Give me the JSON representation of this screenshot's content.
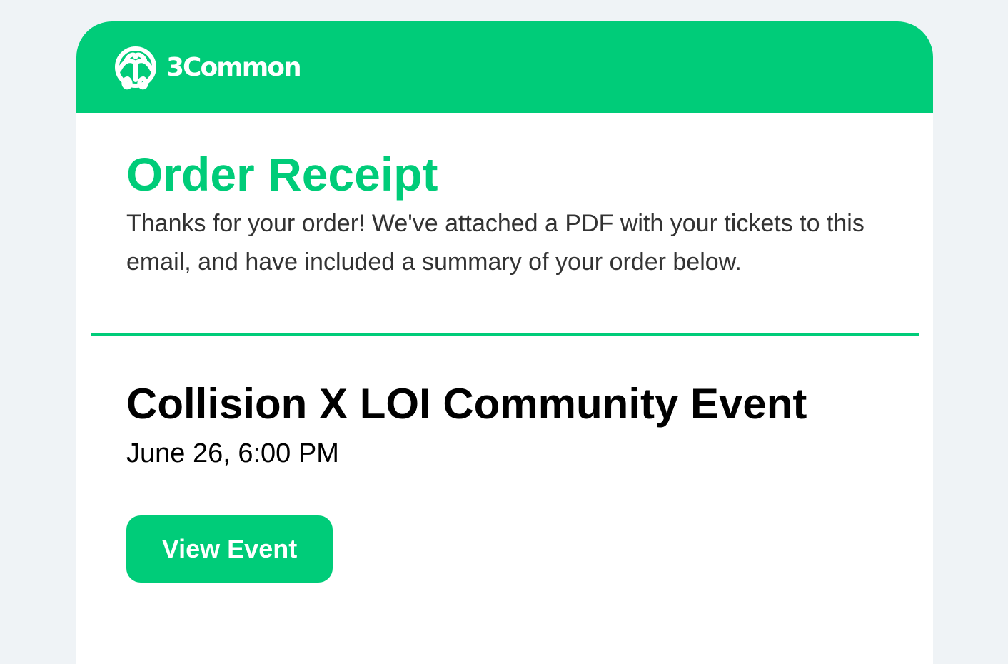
{
  "header": {
    "brand": {
      "name": "3Common",
      "icon": "3common-logo-icon"
    }
  },
  "receipt": {
    "title": "Order Receipt",
    "intro": "Thanks for your order! We've attached a PDF with your tickets to this email, and have included a summary of your order below."
  },
  "event": {
    "title": "Collision X LOI Community Event",
    "date": "June 26, 6:00 PM",
    "button_label": "View Event"
  },
  "colors": {
    "brand_green": "#00cc79",
    "page_background": "#eff3f6",
    "body_text": "#333333",
    "heading_text": "#000000"
  }
}
